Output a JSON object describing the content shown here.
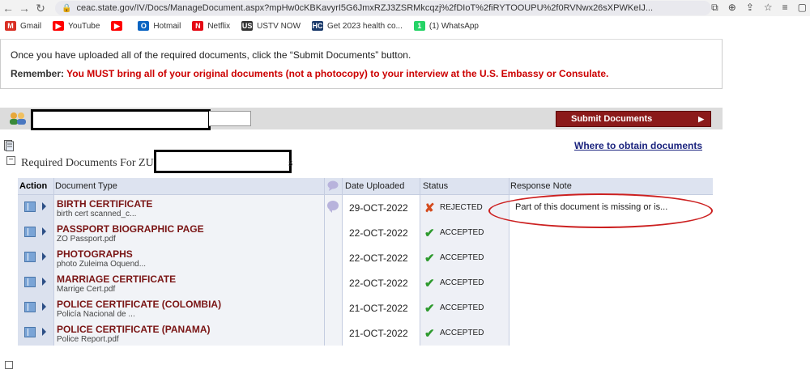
{
  "browser": {
    "url": "ceac.state.gov/IV/Docs/ManageDocument.aspx?mpHw0cKBKavyrI5G6JmxRZJ3ZSRMkcqzj%2fDIoT%2fiRYTOOUPU%2f0RVNwx26sXPWKeIJ...",
    "bookmarks": [
      {
        "label": "Gmail",
        "icon": "gmail-icon",
        "color": "#d93025",
        "glyph": "M"
      },
      {
        "label": "YouTube",
        "icon": "youtube-icon",
        "color": "#ff0000",
        "glyph": "▶"
      },
      {
        "label": "",
        "icon": "youtube-icon",
        "color": "#ff0000",
        "glyph": "▶"
      },
      {
        "label": "Hotmail",
        "icon": "outlook-icon",
        "color": "#0a64c2",
        "glyph": "O"
      },
      {
        "label": "Netflix",
        "icon": "netflix-icon",
        "color": "#e50914",
        "glyph": "N"
      },
      {
        "label": "USTV NOW",
        "icon": "ustv-icon",
        "color": "#333333",
        "glyph": "US"
      },
      {
        "label": "Get 2023 health co...",
        "icon": "hc-icon",
        "color": "#1a3a6b",
        "glyph": "HC"
      },
      {
        "label": "(1) WhatsApp",
        "icon": "whatsapp-icon",
        "color": "#25d366",
        "glyph": "1"
      }
    ]
  },
  "info": {
    "upload_text": "Once you have uploaded all of the required documents, click the “Submit Documents” button.",
    "remember_label": "Remember:",
    "remember_msg": "You MUST bring all of your original documents (not a photocopy) to your interview at the U.S. Embassy or Consulate."
  },
  "toolbar": {
    "submit_label": "Submit Documents"
  },
  "links": {
    "where_docs": "Where to obtain documents"
  },
  "section": {
    "title_prefix": "Required Documents For ZU",
    "title_suffix": "s"
  },
  "table": {
    "headers": {
      "action": "Action",
      "doc_type": "Document Type",
      "date": "Date Uploaded",
      "status": "Status",
      "note": "Response Note"
    },
    "rows": [
      {
        "name": "BIRTH CERTIFICATE",
        "file": "birth cert scanned_c...",
        "date": "29-OCT-2022",
        "status": "REJECTED",
        "rejected": true,
        "note": "Part of this document is missing or is...",
        "bubble": true
      },
      {
        "name": "PASSPORT BIOGRAPHIC PAGE",
        "file": "ZO Passport.pdf",
        "date": "22-OCT-2022",
        "status": "ACCEPTED",
        "rejected": false,
        "note": "",
        "bubble": false
      },
      {
        "name": "PHOTOGRAPHS",
        "file": "photo Zuleima Oquend...",
        "date": "22-OCT-2022",
        "status": "ACCEPTED",
        "rejected": false,
        "note": "",
        "bubble": false
      },
      {
        "name": "MARRIAGE CERTIFICATE",
        "file": "Marrige Cert.pdf",
        "date": "22-OCT-2022",
        "status": "ACCEPTED",
        "rejected": false,
        "note": "",
        "bubble": false
      },
      {
        "name": "POLICE CERTIFICATE (COLOMBIA)",
        "file": "Policía Nacional de ...",
        "date": "21-OCT-2022",
        "status": "ACCEPTED",
        "rejected": false,
        "note": "",
        "bubble": false
      },
      {
        "name": "POLICE CERTIFICATE (PANAMA)",
        "file": "Police Report.pdf",
        "date": "21-OCT-2022",
        "status": "ACCEPTED",
        "rejected": false,
        "note": "",
        "bubble": false
      }
    ]
  },
  "colors": {
    "accent_red": "#cc0000",
    "doc_name": "#7a1515",
    "submit_bg": "#8b1a1a",
    "header_bg": "#dde3f0"
  }
}
